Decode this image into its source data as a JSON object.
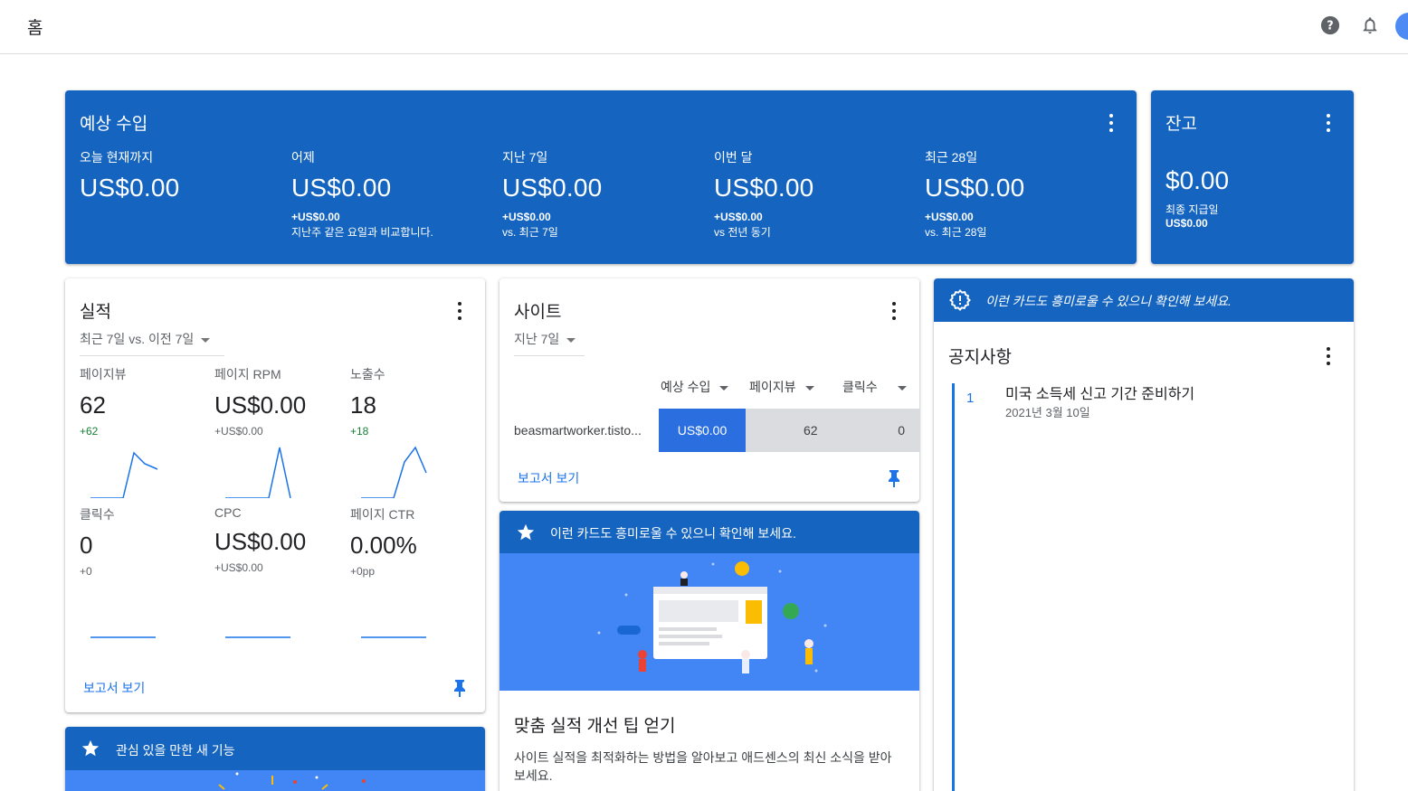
{
  "topbar": {
    "title": "홈"
  },
  "estimated": {
    "title": "예상 수입",
    "columns": [
      {
        "label": "오늘 현재까지",
        "value": "US$0.00",
        "delta": "",
        "compare": ""
      },
      {
        "label": "어제",
        "value": "US$0.00",
        "delta": "+US$0.00",
        "compare": "지난주 같은 요일과 비교합니다."
      },
      {
        "label": "지난 7일",
        "value": "US$0.00",
        "delta": "+US$0.00",
        "compare": "vs. 최근 7일"
      },
      {
        "label": "이번 달",
        "value": "US$0.00",
        "delta": "+US$0.00",
        "compare": "vs 전년 동기"
      },
      {
        "label": "최근 28일",
        "value": "US$0.00",
        "delta": "+US$0.00",
        "compare": "vs. 최근 28일"
      }
    ]
  },
  "balance": {
    "title": "잔고",
    "value": "$0.00",
    "last_payment_label": "최종 지급일",
    "last_payment_value": "US$0.00"
  },
  "performance": {
    "title": "실적",
    "range": "최근 7일 vs. 이전 7일",
    "metrics": [
      {
        "label": "페이지뷰",
        "value": "62",
        "delta": "+62"
      },
      {
        "label": "페이지 RPM",
        "value": "US$0.00",
        "delta": "+US$0.00"
      },
      {
        "label": "노출수",
        "value": "18",
        "delta": "+18"
      },
      {
        "label": "클릭수",
        "value": "0",
        "delta": "+0"
      },
      {
        "label": "CPC",
        "value": "US$0.00",
        "delta": "+US$0.00"
      },
      {
        "label": "페이지 CTR",
        "value": "0.00%",
        "delta": "+0pp"
      }
    ],
    "report_link": "보고서 보기"
  },
  "sites": {
    "title": "사이트",
    "range": "지난 7일",
    "columns": [
      "예상 수입",
      "페이지뷰",
      "클릭수"
    ],
    "rows": [
      {
        "site": "beasmartworker.tisto...",
        "earnings": "US$0.00",
        "pageviews": "62",
        "clicks": "0"
      }
    ],
    "report_link": "보고서 보기"
  },
  "tip": {
    "banner": "이런 카드도 흥미로울 수 있으니 확인해 보세요.",
    "title": "맞춤 실적 개선 팁 얻기",
    "body": "사이트 실적을 최적화하는 방법을 알아보고 애드센스의 최신 소식을 받아보세요."
  },
  "notice": {
    "banner": "이런 카드도 흥미로울 수 있으니 확인해 보세요.",
    "title": "공지사항",
    "items": [
      {
        "num": "1",
        "title": "미국 소득세 신고 기간 준비하기",
        "date": "2021년 3월 10일"
      }
    ]
  },
  "feature": {
    "banner": "관심 있을 만한 새 기능"
  },
  "colors": {
    "primary": "#1565c0",
    "accent": "#1a73e8",
    "illustration": "#4285f4",
    "positive": "#188038"
  }
}
